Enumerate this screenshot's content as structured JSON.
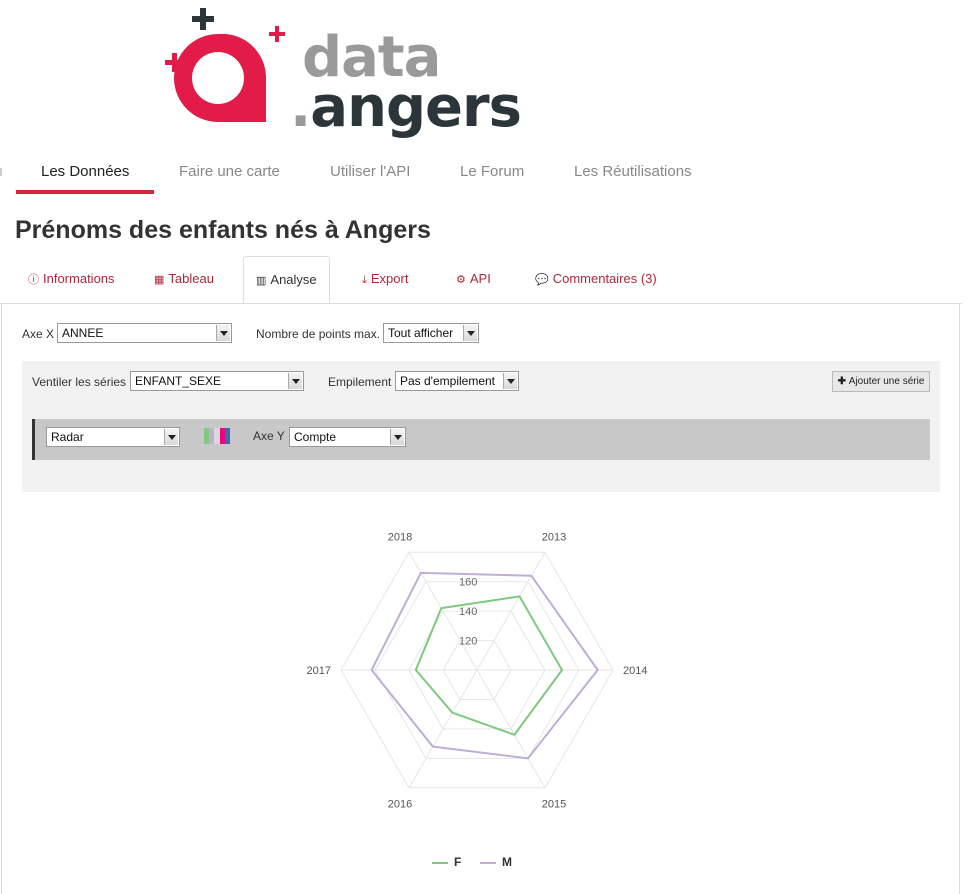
{
  "brand": {
    "word1": "data",
    "word2": "angers",
    "dot": ".",
    "colors": {
      "red": "#e31b48",
      "grey": "#9a9a9a",
      "dark": "#2c353a"
    }
  },
  "main_nav": [
    {
      "label": "Les Données",
      "active": true
    },
    {
      "label": "Faire une carte",
      "active": false
    },
    {
      "label": "Utiliser l'API",
      "active": false
    },
    {
      "label": "Le Forum",
      "active": false
    },
    {
      "label": "Les Réutilisations",
      "active": false
    }
  ],
  "page_title": "Prénoms des enfants nés à Angers",
  "tabs": [
    {
      "label": "Informations",
      "icon": "info-circle-icon",
      "active": false
    },
    {
      "label": "Tableau",
      "icon": "table-icon",
      "active": false
    },
    {
      "label": "Analyse",
      "icon": "bar-chart-icon",
      "active": true
    },
    {
      "label": "Export",
      "icon": "download-icon",
      "active": false
    },
    {
      "label": "API",
      "icon": "cogs-icon",
      "active": false
    },
    {
      "label": "Commentaires (3)",
      "icon": "comments-icon",
      "active": false
    }
  ],
  "controls": {
    "axe_x_label": "Axe X",
    "axe_x_value": "ANNEE",
    "max_points_label": "Nombre de points max.",
    "max_points_value": "Tout afficher",
    "ventiler_label": "Ventiler les séries",
    "ventiler_value": "ENFANT_SEXE",
    "empilement_label": "Empilement",
    "empilement_value": "Pas d'empilement",
    "add_series_label": "Ajouter une série",
    "chart_type_value": "Radar",
    "axe_y_label": "Axe Y",
    "axe_y_value": "Compte",
    "palette": [
      "#7fc97f",
      "#beaed4",
      "#d9d9d9",
      "#f0027f",
      "#386cb0"
    ]
  },
  "chart_data": {
    "type": "radar",
    "categories": [
      "2013",
      "2014",
      "2015",
      "2016",
      "2017",
      "2018"
    ],
    "radial_ticks": [
      120,
      140,
      160
    ],
    "r_max": 180,
    "r_min": 100,
    "series": [
      {
        "name": "F",
        "color": "#7fc97f",
        "values": [
          150,
          150,
          144,
          129,
          136,
          142
        ]
      },
      {
        "name": "M",
        "color": "#beaed4",
        "values": [
          164,
          171,
          160,
          152,
          162,
          166
        ]
      }
    ],
    "legend_position": "bottom"
  }
}
